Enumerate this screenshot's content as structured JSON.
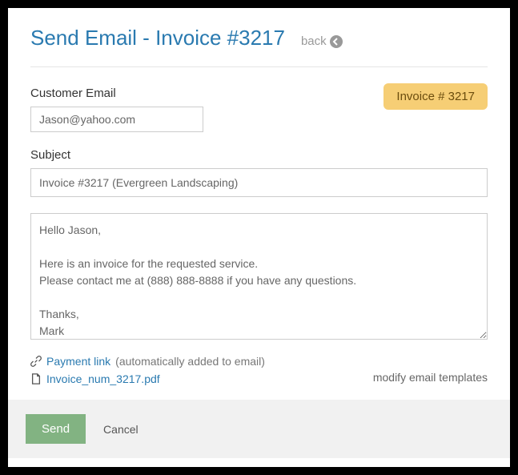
{
  "header": {
    "title": "Send Email - Invoice #3217",
    "back_label": "back"
  },
  "badge": {
    "label": "Invoice # 3217"
  },
  "form": {
    "email_label": "Customer Email",
    "email_value": "Jason@yahoo.com",
    "subject_label": "Subject",
    "subject_value": "Invoice #3217 (Evergreen Landscaping)",
    "body_value": "Hello Jason,\n\nHere is an invoice for the requested service.\nPlease contact me at (888) 888-8888 if you have any questions.\n\nThanks,\nMark"
  },
  "attachments": {
    "payment_link_label": "Payment link",
    "payment_link_note": "(automatically added to email)",
    "pdf_name": "Invoice_num_3217.pdf",
    "modify_templates": "modify email templates"
  },
  "footer": {
    "send_label": "Send",
    "cancel_label": "Cancel"
  }
}
